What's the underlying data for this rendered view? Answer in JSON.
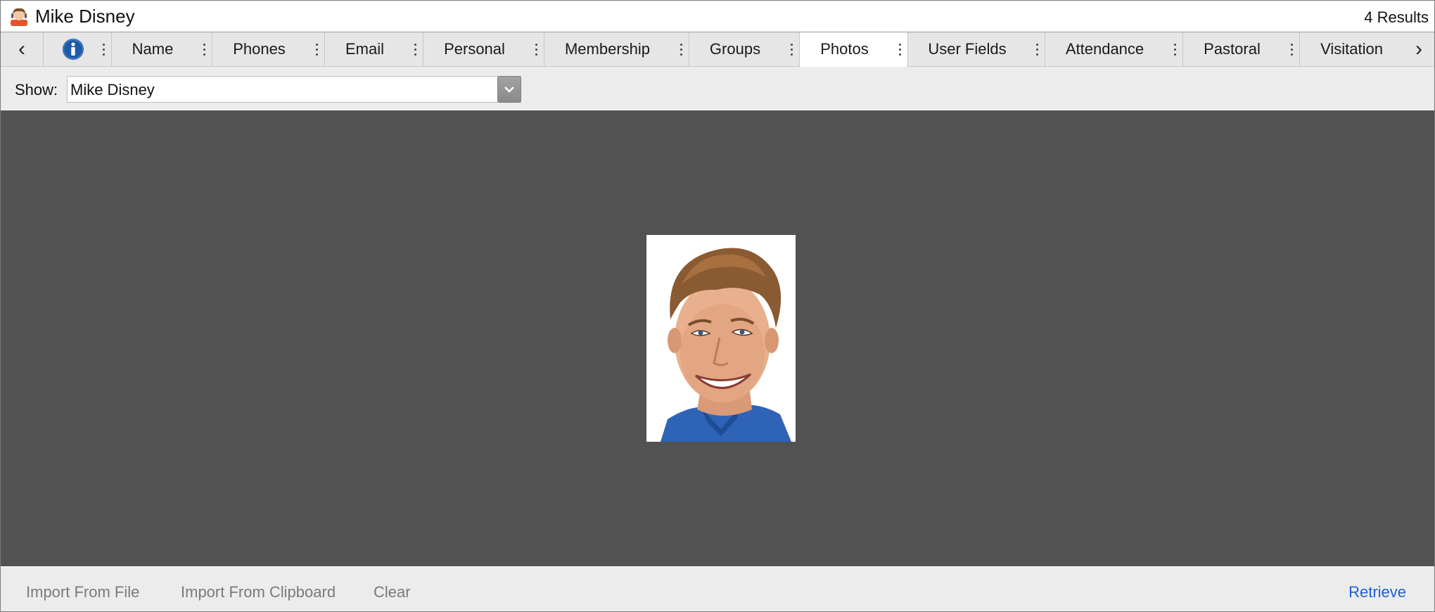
{
  "window": {
    "title": "Mike Disney",
    "results": "4 Results"
  },
  "tabs": {
    "prev_label": "‹",
    "next_label": "›",
    "items": [
      {
        "label": "Name"
      },
      {
        "label": "Phones"
      },
      {
        "label": "Email"
      },
      {
        "label": "Personal"
      },
      {
        "label": "Membership"
      },
      {
        "label": "Groups"
      },
      {
        "label": "Photos",
        "active": true
      },
      {
        "label": "User Fields"
      },
      {
        "label": "Attendance"
      },
      {
        "label": "Pastoral"
      },
      {
        "label": "Visitation"
      }
    ]
  },
  "show": {
    "label": "Show:",
    "value": "Mike Disney"
  },
  "photo": {
    "subject": "portrait-photo"
  },
  "actions": {
    "import_file": "Import From File",
    "import_clipboard": "Import From Clipboard",
    "clear": "Clear",
    "retrieve": "Retrieve"
  },
  "colors": {
    "accent": "#1f5fd6",
    "info_icon": "#1e5aa8",
    "photo_bg": "#525252"
  }
}
